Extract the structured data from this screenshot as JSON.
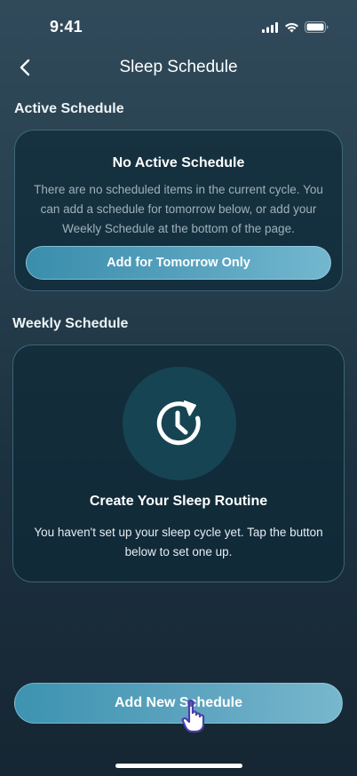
{
  "status_bar": {
    "time": "9:41",
    "icons": [
      "signal-icon",
      "wifi-icon",
      "battery-icon"
    ]
  },
  "nav": {
    "title": "Sleep Schedule",
    "back_icon": "chevron-left-icon"
  },
  "active_schedule": {
    "section_title": "Active Schedule",
    "card_title": "No Active Schedule",
    "description": "There are no scheduled items in the current cycle. You can add a schedule for tomorrow below, or add your Weekly Schedule at the bottom of the page.",
    "button_label": "Add for Tomorrow Only"
  },
  "weekly_schedule": {
    "section_title": "Weekly Schedule",
    "icon": "clock-rotate-icon",
    "card_title": "Create Your Sleep Routine",
    "description": "You haven't set up your sleep cycle yet. Tap the button below to set one up."
  },
  "footer": {
    "button_label": "Add New Schedule"
  },
  "colors": {
    "background_top": "#314a5b",
    "background_bottom": "#162633",
    "card_background": "#0e2a38",
    "card_border": "#6eaabe",
    "accent": "#4a9ab8",
    "clock_circle": "#164453",
    "cursor": "#4b3fa8"
  }
}
